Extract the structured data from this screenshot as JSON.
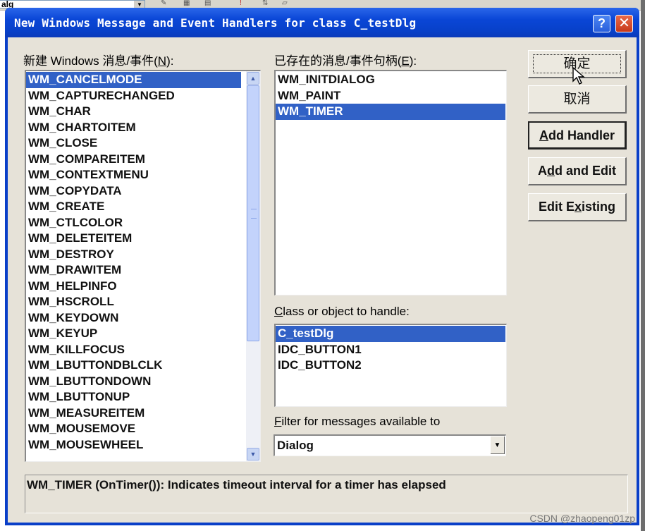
{
  "background_app": {
    "combo_value": "alg"
  },
  "dialog": {
    "title": "New Windows Message and Event Handlers for class C_testDlg",
    "help_glyph": "?",
    "close_glyph": "✕"
  },
  "new_messages": {
    "label_pre": "新建 Windows 消息/事件(",
    "label_key": "N",
    "label_post": "):",
    "items": [
      "WM_CANCELMODE",
      "WM_CAPTURECHANGED",
      "WM_CHAR",
      "WM_CHARTOITEM",
      "WM_CLOSE",
      "WM_COMPAREITEM",
      "WM_CONTEXTMENU",
      "WM_COPYDATA",
      "WM_CREATE",
      "WM_CTLCOLOR",
      "WM_DELETEITEM",
      "WM_DESTROY",
      "WM_DRAWITEM",
      "WM_HELPINFO",
      "WM_HSCROLL",
      "WM_KEYDOWN",
      "WM_KEYUP",
      "WM_KILLFOCUS",
      "WM_LBUTTONDBLCLK",
      "WM_LBUTTONDOWN",
      "WM_LBUTTONUP",
      "WM_MEASUREITEM",
      "WM_MOUSEMOVE",
      "WM_MOUSEWHEEL"
    ],
    "selected_index": 0
  },
  "existing_handlers": {
    "label_pre": "已存在的消息/事件句柄(",
    "label_key": "E",
    "label_post": "):",
    "items": [
      "WM_INITDIALOG",
      "WM_PAINT",
      "WM_TIMER"
    ],
    "selected_index": 2
  },
  "class_objects": {
    "label_key": "C",
    "label_rest": "lass or object to handle:",
    "items": [
      "C_testDlg",
      "IDC_BUTTON1",
      "IDC_BUTTON2"
    ],
    "selected_index": 0
  },
  "filter": {
    "label_key": "F",
    "label_rest": "ilter for messages available to",
    "value": "Dialog"
  },
  "buttons": {
    "ok": "确定",
    "cancel": "取消",
    "add_handler_key": "A",
    "add_handler_rest": "dd Handler",
    "add_edit_pre": "A",
    "add_edit_key": "d",
    "add_edit_post": "d and Edit",
    "edit_existing_pre": "Edit E",
    "edit_existing_key": "x",
    "edit_existing_post": "isting"
  },
  "status": {
    "text": "WM_TIMER (OnTimer()):  Indicates timeout interval for a timer has elapsed"
  },
  "watermark": "CSDN @zhaopeng01zp",
  "colors": {
    "selection": "#3161c6",
    "titlebar": "#0a46d6",
    "dialog_face": "#e6e2d8"
  }
}
